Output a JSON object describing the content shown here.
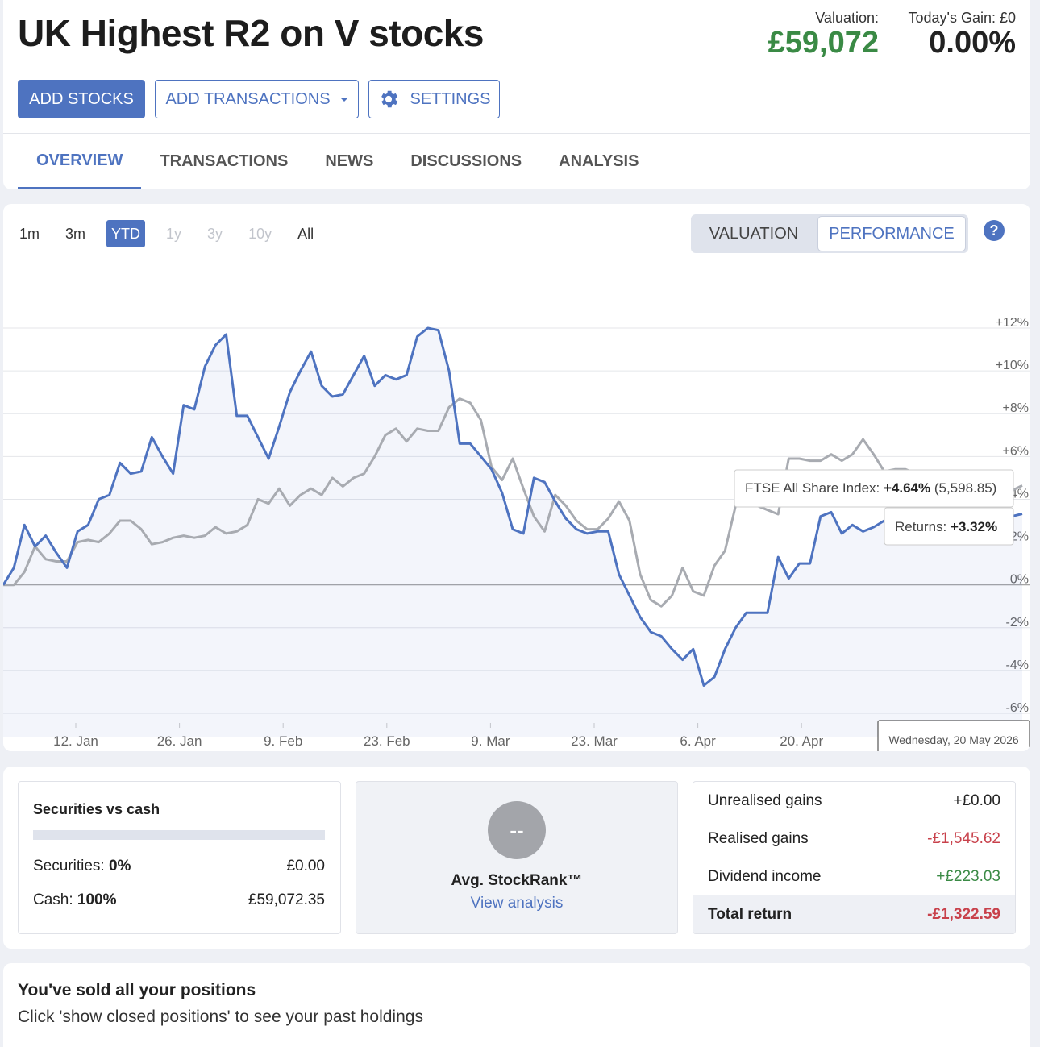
{
  "portfolio": {
    "title": "UK Highest R2 on V stocks",
    "valuation_label": "Valuation:",
    "valuation_value": "£59,072",
    "gain_label": "Today's Gain: £0",
    "gain_value": "0.00%"
  },
  "toolbar": {
    "add_stocks": "ADD STOCKS",
    "add_transactions": "ADD TRANSACTIONS",
    "settings": "SETTINGS"
  },
  "tabs": [
    "OVERVIEW",
    "TRANSACTIONS",
    "NEWS",
    "DISCUSSIONS",
    "ANALYSIS"
  ],
  "active_tab": "OVERVIEW",
  "ranges": [
    {
      "label": "1m",
      "state": "normal"
    },
    {
      "label": "3m",
      "state": "normal"
    },
    {
      "label": "YTD",
      "state": "selected"
    },
    {
      "label": "1y",
      "state": "disabled"
    },
    {
      "label": "3y",
      "state": "disabled"
    },
    {
      "label": "10y",
      "state": "disabled"
    },
    {
      "label": "All",
      "state": "normal"
    }
  ],
  "view_toggle": {
    "valuation": "VALUATION",
    "performance": "PERFORMANCE",
    "selected": "PERFORMANCE"
  },
  "help_icon": "?",
  "chart_data": {
    "type": "line",
    "ylim": [
      -6,
      12
    ],
    "y_ticks": [
      "+12%",
      "+10%",
      "+8%",
      "+6%",
      "4%",
      "2%",
      "0%",
      "-2%",
      "-4%",
      "-6%"
    ],
    "x_ticks": [
      "12. Jan",
      "26. Jan",
      "9. Feb",
      "23. Feb",
      "9. Mar",
      "23. Mar",
      "6. Apr",
      "20. Apr"
    ],
    "series": [
      {
        "name": "Returns",
        "color": "#4e73c0",
        "values": [
          0.0,
          0.8,
          2.8,
          1.8,
          2.3,
          1.5,
          0.8,
          2.5,
          2.8,
          4.0,
          4.2,
          5.7,
          5.2,
          5.3,
          6.9,
          6.0,
          5.2,
          8.4,
          8.2,
          10.2,
          11.2,
          11.7,
          7.9,
          7.9,
          6.9,
          5.9,
          7.4,
          9.0,
          10.0,
          10.9,
          9.3,
          8.8,
          8.9,
          9.8,
          10.7,
          9.3,
          9.8,
          9.6,
          9.8,
          11.6,
          12.0,
          11.9,
          10.0,
          6.6,
          6.6,
          6.0,
          5.4,
          4.3,
          2.6,
          2.4,
          5.0,
          4.8,
          3.9,
          3.1,
          2.6,
          2.4,
          2.5,
          2.5,
          0.5,
          -0.5,
          -1.5,
          -2.2,
          -2.4,
          -3.0,
          -3.5,
          -3.0,
          -4.7,
          -4.3,
          -3.0,
          -2.0,
          -1.3,
          -1.3,
          -1.3,
          1.3,
          0.3,
          1.0,
          1.0,
          3.2,
          3.4,
          2.4,
          2.8,
          2.5,
          2.7,
          3.0,
          3.2,
          3.2,
          3.2,
          3.2,
          3.2,
          3.2,
          3.2,
          3.2,
          3.2,
          3.2,
          3.2,
          3.2,
          3.32
        ]
      },
      {
        "name": "FTSE All Share Index",
        "color": "#a8abb1",
        "values": [
          0.0,
          0.0,
          0.6,
          1.8,
          1.2,
          1.1,
          1.1,
          2.0,
          2.1,
          2.0,
          2.4,
          3.0,
          3.0,
          2.6,
          1.9,
          2.0,
          2.2,
          2.3,
          2.2,
          2.3,
          2.7,
          2.4,
          2.5,
          2.8,
          4.0,
          3.8,
          4.5,
          3.7,
          4.2,
          4.5,
          4.2,
          5.0,
          4.6,
          5.0,
          5.2,
          6.0,
          7.0,
          7.3,
          6.7,
          7.3,
          7.2,
          7.2,
          8.3,
          8.7,
          8.5,
          7.7,
          5.5,
          4.9,
          5.9,
          4.5,
          3.2,
          2.5,
          4.2,
          3.7,
          3.0,
          2.6,
          2.6,
          3.1,
          3.9,
          3.0,
          0.5,
          -0.7,
          -1.0,
          -0.5,
          0.8,
          -0.3,
          -0.5,
          0.9,
          1.6,
          3.7,
          4.0,
          3.7,
          3.5,
          3.3,
          5.9,
          5.9,
          5.8,
          5.8,
          6.1,
          5.8,
          6.1,
          6.8,
          6.1,
          5.3,
          5.4,
          5.4,
          5.2,
          4.2,
          3.6,
          3.5,
          3.5,
          2.4,
          3.4,
          4.2,
          4.5,
          4.4,
          4.64
        ]
      }
    ],
    "tooltip_ftse": {
      "label": "FTSE All Share Index:",
      "value": "+4.64%",
      "extra": "(5,598.85)"
    },
    "tooltip_returns": {
      "label": "Returns:",
      "value": "+3.32%"
    },
    "date_label": "Wednesday, 20 May 2026"
  },
  "summary": {
    "securities_title": "Securities vs cash",
    "securities_label": "Securities:",
    "securities_pct": "0%",
    "securities_value": "£0.00",
    "cash_label": "Cash:",
    "cash_pct": "100%",
    "cash_value": "£59,072.35",
    "rank_placeholder": "--",
    "rank_label": "Avg. StockRank™",
    "rank_link": "View analysis",
    "gains": [
      {
        "label": "Unrealised gains",
        "value": "+£0.00",
        "tone": "neutral"
      },
      {
        "label": "Realised gains",
        "value": "-£1,545.62",
        "tone": "negative"
      },
      {
        "label": "Dividend income",
        "value": "+£223.03",
        "tone": "positive"
      },
      {
        "label": "Total return",
        "value": "-£1,322.59",
        "tone": "negative"
      }
    ]
  },
  "positions": {
    "title": "You've sold all your positions",
    "subtitle": "Click 'show closed positions' to see your past holdings"
  },
  "colors": {
    "accent": "#4e73c0",
    "positive": "#3a8a45",
    "negative": "#c8414b"
  }
}
